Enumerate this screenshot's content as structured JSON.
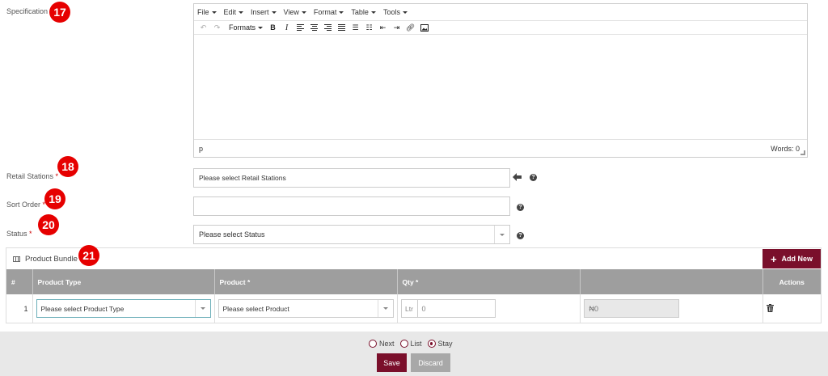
{
  "labels": {
    "specification": "Specification",
    "retail_stations": "Retail Stations",
    "sort_order": "Sort Order",
    "status": "Status",
    "required_mark": "*"
  },
  "badges": [
    "17",
    "18",
    "19",
    "20",
    "21"
  ],
  "editor": {
    "menu": [
      "File",
      "Edit",
      "Insert",
      "View",
      "Format",
      "Table",
      "Tools"
    ],
    "formats_label": "Formats",
    "path": "p",
    "word_count": "Words: 0"
  },
  "fields": {
    "retail_stations_placeholder": "Please select Retail Stations",
    "sort_order_value": "",
    "status_placeholder": "Please select Status",
    "help_glyph": "?"
  },
  "bundle": {
    "title": "Product Bundle",
    "add_new_label": "Add New",
    "add_new_glyph": "+",
    "columns": [
      "#",
      "Product Type",
      "Product *",
      "Qty *",
      "",
      "Actions"
    ],
    "rows": [
      {
        "index": "1",
        "product_type": "Please select Product Type",
        "product": "Please select Product",
        "qty_unit": "Ltr",
        "qty": "0",
        "amount": "₦0"
      }
    ]
  },
  "footer": {
    "radio_options": [
      "Next",
      "List",
      "Stay"
    ],
    "selected_option": "Stay",
    "save_label": "Save",
    "discard_label": "Discard"
  },
  "colors": {
    "primary": "#7a0f2b",
    "badge": "#e60000",
    "table_header": "#9e9e9e"
  },
  "icons": [
    "undo-icon",
    "redo-icon",
    "bold-icon",
    "italic-icon",
    "align-left-icon",
    "align-center-icon",
    "align-right-icon",
    "align-justify-icon",
    "bullet-list-icon",
    "numbered-list-icon",
    "outdent-icon",
    "indent-icon",
    "link-icon",
    "image-icon",
    "arrow-left-icon",
    "help-icon",
    "grid-icon",
    "plus-icon",
    "trash-icon"
  ]
}
